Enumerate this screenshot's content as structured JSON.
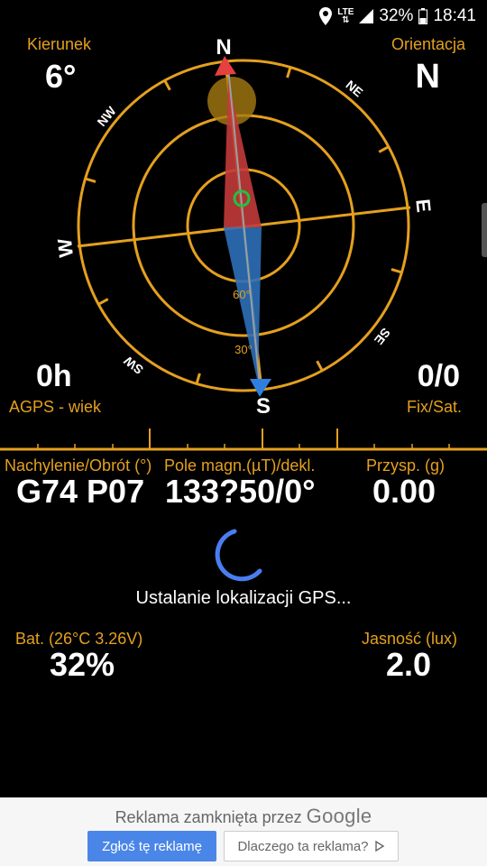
{
  "status": {
    "network": "LTE",
    "battery": "32%",
    "time": "18:41",
    "icons": [
      "location-icon",
      "signal-icon",
      "battery-icon"
    ]
  },
  "compass": {
    "heading_label": "Kierunek",
    "heading_value": "6°",
    "orientation_label": "Orientacja",
    "orientation_value": "N",
    "agps_value": "0h",
    "agps_label": "AGPS - wiek",
    "fix_value": "0/0",
    "fix_label": "Fix/Sat.",
    "directions": {
      "n": "N",
      "ne": "NE",
      "e": "E",
      "se": "SE",
      "s": "S",
      "sw": "SW",
      "w": "W",
      "nw": "NW"
    },
    "ring_60": "60°",
    "ring_30": "30°",
    "colors": {
      "ring": "#e4a01e",
      "north": "#e03c3c",
      "south": "#2f7fe0",
      "accent": "#22c040"
    }
  },
  "sensors": {
    "tilt_label": "Nachylenie/Obrót (°)",
    "tilt_value": "G74 P07",
    "mag_label": "Pole magn.(µT)/dekl.",
    "mag_value": "133?50/0°",
    "accel_label": "Przysp. (g)",
    "accel_value": "0.00"
  },
  "loading": {
    "text": "Ustalanie lokalizacji GPS..."
  },
  "battery": {
    "label": "Bat. (26°C 3.26V)",
    "value": "32%"
  },
  "light": {
    "label": "Jasność (lux)",
    "value": "2.0"
  },
  "ad": {
    "closed_text": "Reklama zamknięta przez",
    "brand": "Google",
    "report_label": "Zgłoś tę reklamę",
    "why_label": "Dlaczego ta reklama?"
  }
}
